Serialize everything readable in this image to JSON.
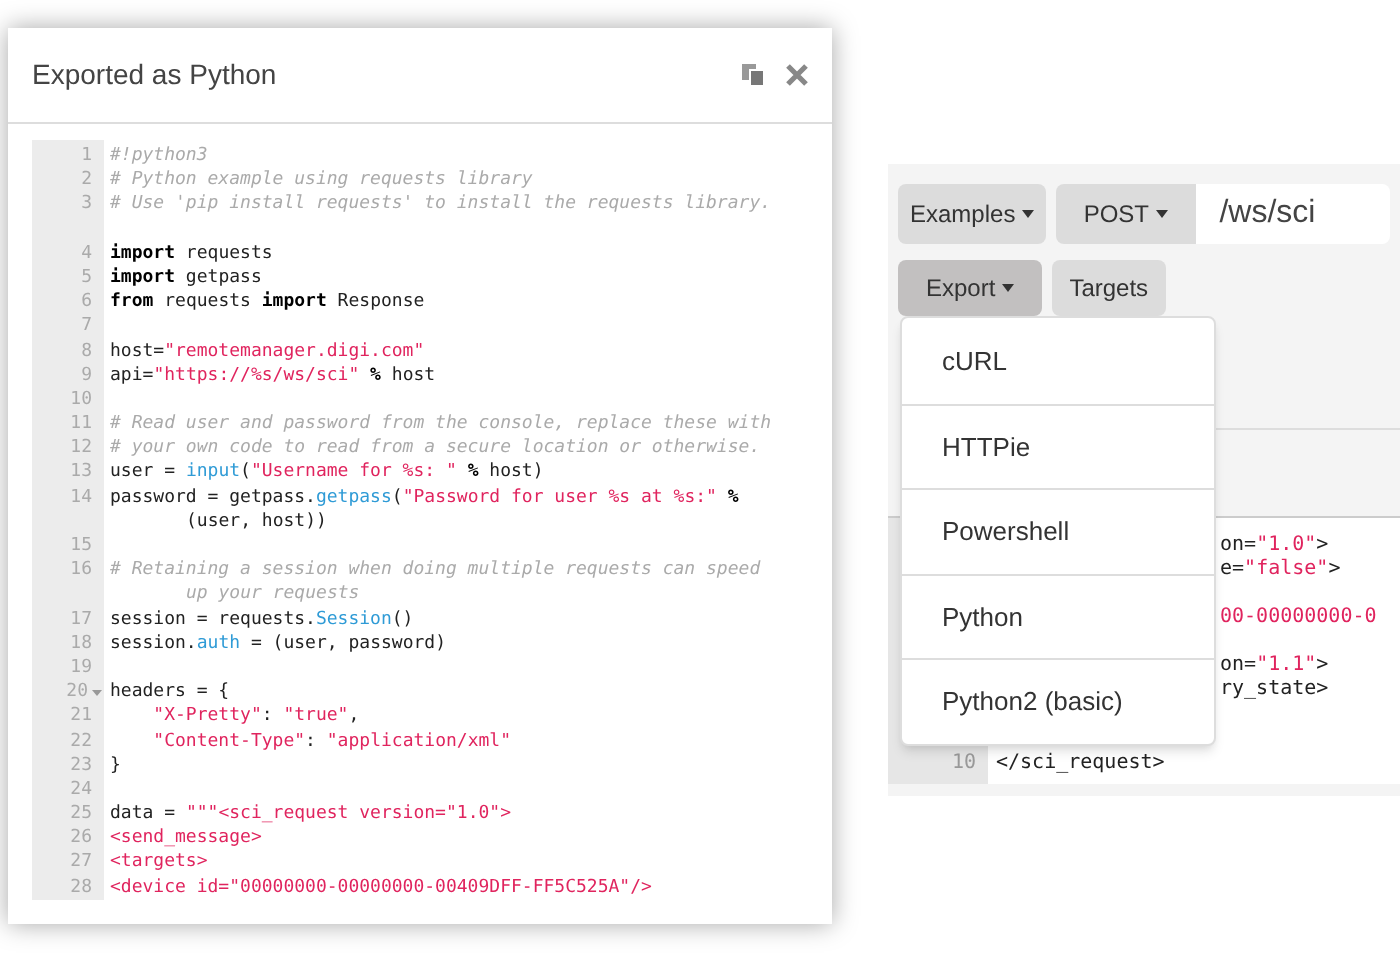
{
  "dialog": {
    "title": "Exported as Python",
    "code": [
      {
        "number": "1",
        "tokens": [
          {
            "kind": "comment",
            "text": "#!python3"
          }
        ]
      },
      {
        "number": "2",
        "tokens": [
          {
            "kind": "comment",
            "text": "# Python example using requests library"
          }
        ]
      },
      {
        "number": "3",
        "tokens": [
          {
            "kind": "comment",
            "text": "# Use 'pip install requests' to install the requests library."
          }
        ]
      },
      {
        "number": "4",
        "gap_before": true,
        "tokens": [
          {
            "kind": "keyword",
            "text": "import"
          },
          {
            "kind": "plain",
            "text": " requests"
          }
        ]
      },
      {
        "number": "5",
        "tokens": [
          {
            "kind": "keyword",
            "text": "import"
          },
          {
            "kind": "plain",
            "text": " getpass"
          }
        ]
      },
      {
        "number": "6",
        "tokens": [
          {
            "kind": "keyword",
            "text": "from"
          },
          {
            "kind": "plain",
            "text": " requests "
          },
          {
            "kind": "keyword",
            "text": "import"
          },
          {
            "kind": "plain",
            "text": " Response"
          }
        ]
      },
      {
        "number": "7"
      },
      {
        "number": "8",
        "tokens": [
          {
            "kind": "plain",
            "text": "host="
          },
          {
            "kind": "string",
            "text": "\"remotemanager.digi.com\""
          }
        ]
      },
      {
        "number": "9",
        "tokens": [
          {
            "kind": "plain",
            "text": "api="
          },
          {
            "kind": "string",
            "text": "\"https://%s/ws/sci\""
          },
          {
            "kind": "keyword",
            "text": " %"
          },
          {
            "kind": "plain",
            "text": " host"
          }
        ]
      },
      {
        "number": "10"
      },
      {
        "number": "11",
        "tokens": [
          {
            "kind": "comment",
            "text": "# Read user and password from the console, replace these with"
          }
        ]
      },
      {
        "number": "12",
        "tokens": [
          {
            "kind": "comment",
            "text": "# your own code to read from a secure location or otherwise."
          }
        ]
      },
      {
        "number": "13",
        "tokens": [
          {
            "kind": "plain",
            "text": "user = "
          },
          {
            "kind": "func",
            "text": "input"
          },
          {
            "kind": "plain",
            "text": "("
          },
          {
            "kind": "string",
            "text": "\"Username for %s: \""
          },
          {
            "kind": "keyword",
            "text": " %"
          },
          {
            "kind": "plain",
            "text": " host)"
          }
        ]
      },
      {
        "number": "14",
        "tokens": [
          {
            "kind": "plain",
            "text": "password = getpass."
          },
          {
            "kind": "func",
            "text": "getpass"
          },
          {
            "kind": "plain",
            "text": "("
          },
          {
            "kind": "string",
            "text": "\"Password for user %s at %s:\""
          },
          {
            "kind": "keyword",
            "text": " %"
          }
        ],
        "continuation": [
          {
            "kind": "plain",
            "text": "(user, host))"
          }
        ]
      },
      {
        "number": "15"
      },
      {
        "number": "16",
        "tokens": [
          {
            "kind": "comment",
            "text": "# Retaining a session when doing multiple requests can speed"
          }
        ],
        "continuation": [
          {
            "kind": "comment",
            "text": "up your requests"
          }
        ]
      },
      {
        "number": "17",
        "tokens": [
          {
            "kind": "plain",
            "text": "session = requests."
          },
          {
            "kind": "func",
            "text": "Session"
          },
          {
            "kind": "plain",
            "text": "()"
          }
        ]
      },
      {
        "number": "18",
        "tokens": [
          {
            "kind": "plain",
            "text": "session."
          },
          {
            "kind": "func",
            "text": "auth"
          },
          {
            "kind": "plain",
            "text": " = (user, password)"
          }
        ]
      },
      {
        "number": "19"
      },
      {
        "number": "20",
        "foldable": true,
        "tokens": [
          {
            "kind": "plain",
            "text": "headers = {"
          }
        ]
      },
      {
        "number": "21",
        "tokens": [
          {
            "kind": "string",
            "text": "    \"X-Pretty\""
          },
          {
            "kind": "plain",
            "text": ": "
          },
          {
            "kind": "string",
            "text": "\"true\""
          },
          {
            "kind": "plain",
            "text": ","
          }
        ]
      },
      {
        "number": "22",
        "tokens": [
          {
            "kind": "string",
            "text": "    \"Content-Type\""
          },
          {
            "kind": "plain",
            "text": ": "
          },
          {
            "kind": "string",
            "text": "\"application/xml\""
          }
        ]
      },
      {
        "number": "23",
        "tokens": [
          {
            "kind": "plain",
            "text": "}"
          }
        ]
      },
      {
        "number": "24"
      },
      {
        "number": "25",
        "tokens": [
          {
            "kind": "plain",
            "text": "data = "
          },
          {
            "kind": "string",
            "text": "\"\"\"<sci_request version=\"1.0\">"
          }
        ]
      },
      {
        "number": "26",
        "tokens": [
          {
            "kind": "string",
            "text": "<send_message>"
          }
        ]
      },
      {
        "number": "27",
        "tokens": [
          {
            "kind": "string",
            "text": "<targets>"
          }
        ]
      },
      {
        "number": "28",
        "tokens": [
          {
            "kind": "string",
            "text": "<device id=\"00000000-00000000-00409DFF-FF5C525A\"/>"
          }
        ]
      }
    ]
  },
  "toolbar": {
    "examples": "Examples",
    "method": "POST",
    "path": "/ws/sci",
    "export": "Export",
    "targets": "Targets"
  },
  "export_menu": {
    "expanded": true,
    "items": [
      "cURL",
      "HTTPie",
      "Powershell",
      "Python",
      "Python2 (basic)"
    ]
  },
  "editor": {
    "fragments": [
      {
        "tokens": [
          {
            "kind": "plain",
            "text": "on="
          },
          {
            "kind": "string",
            "text": "\"1.0\""
          },
          {
            "kind": "plain",
            "text": ">"
          }
        ]
      },
      {
        "tokens": [
          {
            "kind": "plain",
            "text": "e="
          },
          {
            "kind": "string",
            "text": "\"false\""
          },
          {
            "kind": "plain",
            "text": ">"
          }
        ]
      },
      {
        "gap_before": true,
        "tokens": [
          {
            "kind": "string",
            "text": "00-00000000-0"
          }
        ]
      },
      {
        "gap_before": true,
        "tokens": [
          {
            "kind": "plain",
            "text": "on="
          },
          {
            "kind": "string",
            "text": "\"1.1\""
          },
          {
            "kind": "plain",
            "text": ">"
          }
        ]
      },
      {
        "tokens": [
          {
            "kind": "plain",
            "text": "ry_state>"
          }
        ]
      }
    ],
    "last_line": {
      "number": "10",
      "tokens": [
        {
          "kind": "plain",
          "text": "</sci_request>"
        }
      ]
    }
  }
}
